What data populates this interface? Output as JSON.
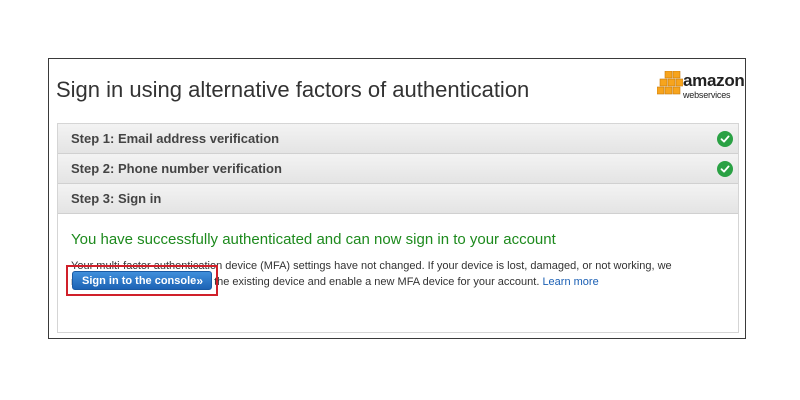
{
  "page": {
    "title": "Sign in using alternative factors of authentication"
  },
  "logo": {
    "name": "amazon",
    "sub": "webservices",
    "icon": "aws-cubes-icon",
    "color": "#f7a41d"
  },
  "steps": [
    {
      "label": "Step 1: Email address verification",
      "completed": true,
      "icon": "check-circle-icon"
    },
    {
      "label": "Step 2: Phone number verification",
      "completed": true,
      "icon": "check-circle-icon"
    },
    {
      "label": "Step 3: Sign in",
      "completed": false
    }
  ],
  "content": {
    "success_message": "You have successfully authenticated and can now sign in to your account",
    "info_text": "Your multi-factor authentication device (MFA) settings have not changed. If your device is lost, damaged, or not working, we recommend that you remove the existing device and enable a new MFA device for your account.",
    "learn_more": "Learn more",
    "button_label": "Sign in to the console",
    "button_icon": "double-chevron-right-icon"
  },
  "colors": {
    "success": "#1d8a1d",
    "check": "#2aa144",
    "button": "#1d63b5",
    "highlight": "#d0202a",
    "link": "#1a5fb4"
  }
}
